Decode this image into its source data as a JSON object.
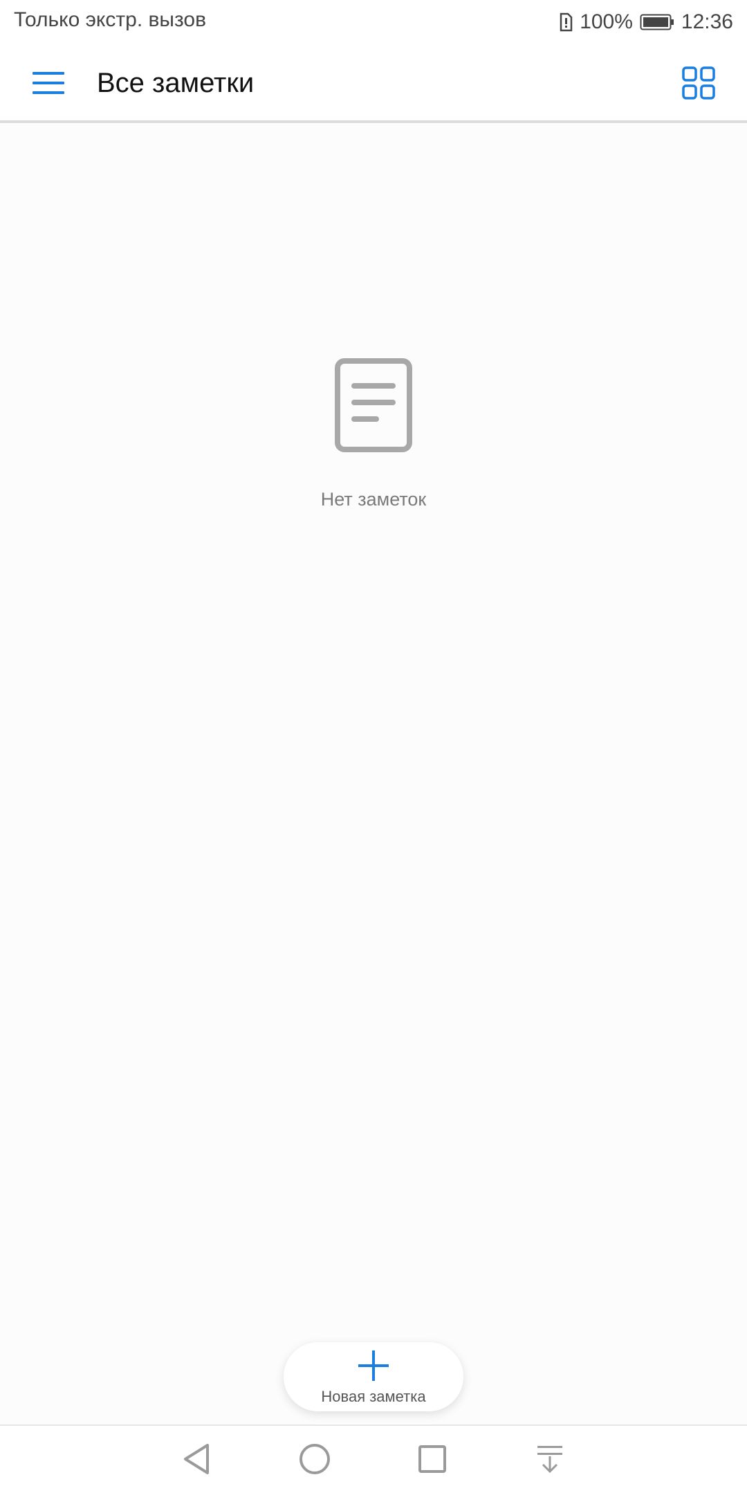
{
  "status_bar": {
    "carrier": "Только экстр. вызов",
    "battery": "100%",
    "time": "12:36"
  },
  "app_bar": {
    "title": "Все заметки",
    "menu_icon": "hamburger-menu-icon",
    "view_icon": "grid-view-icon"
  },
  "empty_state": {
    "icon": "document-icon",
    "text": "Нет заметок"
  },
  "fab": {
    "icon": "plus-icon",
    "label": "Новая заметка"
  },
  "nav_bar": {
    "buttons": [
      "back-icon",
      "home-icon",
      "recents-icon",
      "notifications-pull-icon"
    ]
  },
  "colors": {
    "accent": "#1a7de0",
    "background": "#fcfcfc",
    "icon_gray": "#a8a8a8"
  }
}
